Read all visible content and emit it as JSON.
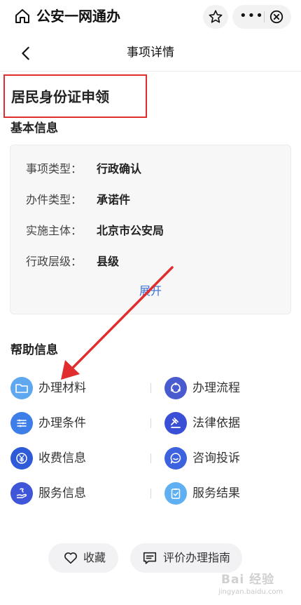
{
  "app": {
    "title": "公安一网通办"
  },
  "nav": {
    "title": "事项详情"
  },
  "item": {
    "title": "居民身份证申领"
  },
  "basic_info": {
    "section_title": "基本信息",
    "rows": [
      {
        "label": "事项类型：",
        "value": "行政确认"
      },
      {
        "label": "办件类型：",
        "value": "承诺件"
      },
      {
        "label": "实施主体：",
        "value": "北京市公安局"
      },
      {
        "label": "行政层级：",
        "value": "县级"
      }
    ],
    "expand_label": "展开"
  },
  "help_info": {
    "section_title": "帮助信息",
    "items": [
      {
        "label": "办理材料",
        "icon": "folder-icon",
        "color": "#5fa8f0"
      },
      {
        "label": "办理流程",
        "icon": "flow-icon",
        "color": "#4a5bd0"
      },
      {
        "label": "办理条件",
        "icon": "list-icon",
        "color": "#3d7ee8"
      },
      {
        "label": "法律依据",
        "icon": "gavel-icon",
        "color": "#3b4fd6"
      },
      {
        "label": "收费信息",
        "icon": "yuan-icon",
        "color": "#2f5ad8"
      },
      {
        "label": "咨询投诉",
        "icon": "chat-icon",
        "color": "#3d62e0"
      },
      {
        "label": "服务信息",
        "icon": "service-icon",
        "color": "#3f56d8"
      },
      {
        "label": "服务结果",
        "icon": "clipboard-check-icon",
        "color": "#5fb0f2"
      }
    ]
  },
  "bottom": {
    "favorite_label": "收藏",
    "review_label": "评价办理指南"
  },
  "watermark": {
    "text": "Bai 经验",
    "sub": "jingyan.baidu.com"
  },
  "colors": {
    "highlight_box": "#e02d2d",
    "annotation_arrow": "#e02d2d",
    "link": "#3a6fd8"
  }
}
